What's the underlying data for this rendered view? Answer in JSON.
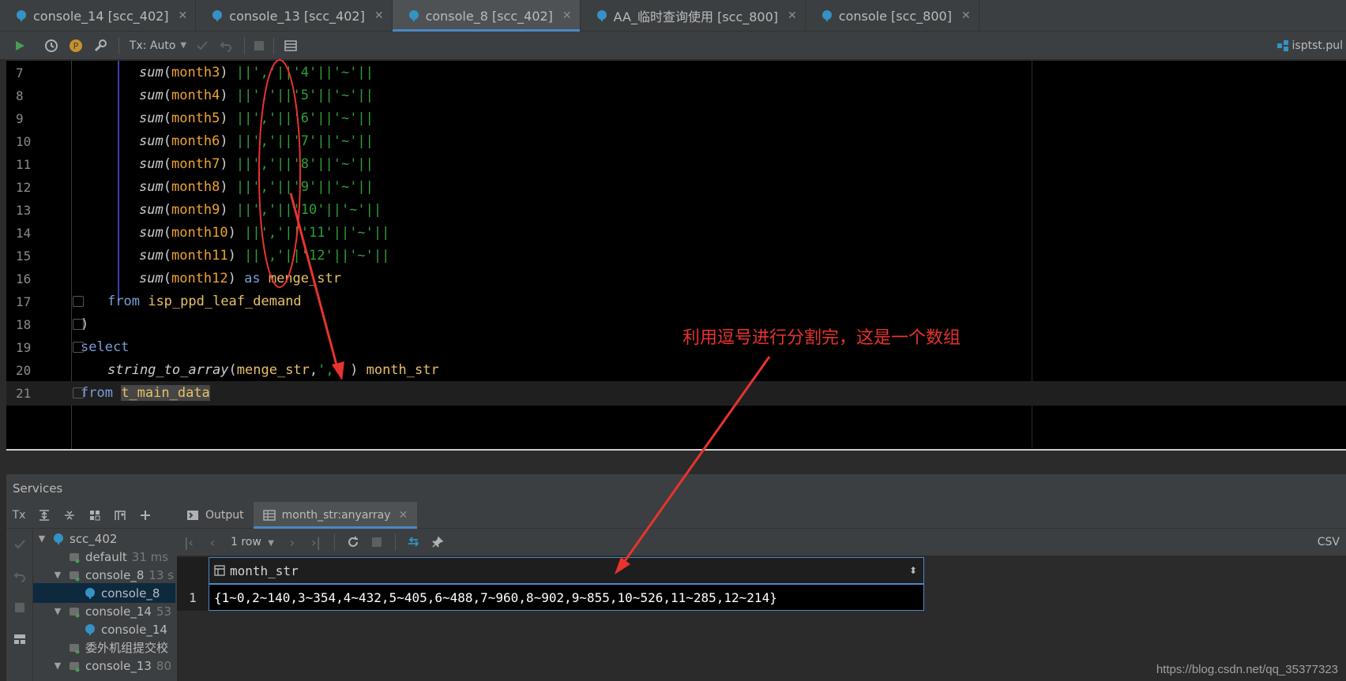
{
  "tabs": [
    {
      "label": "console_14 [scc_402]",
      "active": false
    },
    {
      "label": "console_13 [scc_402]",
      "active": false
    },
    {
      "label": "console_8 [scc_402]",
      "active": true
    },
    {
      "label": "AA_临时查询使用 [scc_800]",
      "active": false
    },
    {
      "label": "console [scc_800]",
      "active": false
    }
  ],
  "toolbar": {
    "tx_mode": "Tx: Auto",
    "datasource": "isptst.pul"
  },
  "editor": {
    "lines": [
      {
        "n": "7",
        "fn": "sum",
        "arg": "month3",
        "sep": "'",
        "num": "4"
      },
      {
        "n": "8",
        "fn": "sum",
        "arg": "month4",
        "num": "5"
      },
      {
        "n": "9",
        "fn": "sum",
        "arg": "month5",
        "num": "6"
      },
      {
        "n": "10",
        "fn": "sum",
        "arg": "month6",
        "num": "7"
      },
      {
        "n": "11",
        "fn": "sum",
        "arg": "month7",
        "num": "8"
      },
      {
        "n": "12",
        "fn": "sum",
        "arg": "month8",
        "num": "9"
      },
      {
        "n": "13",
        "fn": "sum",
        "arg": "month9",
        "num": "10"
      },
      {
        "n": "14",
        "fn": "sum",
        "arg": "month10",
        "num": "11"
      },
      {
        "n": "15",
        "fn": "sum",
        "arg": "month11",
        "num": "12"
      }
    ],
    "line16": {
      "n": "16",
      "fn": "sum",
      "arg": "month12",
      "kw": "as",
      "alias": "menge_str"
    },
    "line17": {
      "n": "17",
      "kw": "from",
      "table": "isp_ppd_leaf_demand"
    },
    "line18": {
      "n": "18",
      "text": ")"
    },
    "line19": {
      "n": "19",
      "kw": "select"
    },
    "line20": {
      "n": "20",
      "fn": "string_to_array",
      "arg": "menge_str",
      "delim": "','",
      "alias": "month_str"
    },
    "line21": {
      "n": "21",
      "kw": "from",
      "table": "t_main_data"
    }
  },
  "annotation": "利用逗号进行分割完，这是一个数组",
  "services": {
    "title": "Services",
    "tx_label": "Tx",
    "tree": [
      {
        "label": "scc_402",
        "meta": "",
        "level": 0,
        "expanded": true
      },
      {
        "label": "default",
        "meta": "31 ms",
        "level": 1
      },
      {
        "label": "console_8",
        "meta": "13 s",
        "level": 1,
        "expanded": true
      },
      {
        "label": "console_8",
        "meta": "",
        "level": 2,
        "selected": true
      },
      {
        "label": "console_14",
        "meta": "53",
        "level": 1,
        "expanded": true
      },
      {
        "label": "console_14",
        "meta": "",
        "level": 2
      },
      {
        "label": "委外机组提交校",
        "meta": "",
        "level": 1
      },
      {
        "label": "console_13",
        "meta": "80",
        "level": 1,
        "expanded": true
      }
    ],
    "result_tabs": [
      {
        "label": "Output",
        "active": false
      },
      {
        "label": "month_str:anyarray",
        "active": true
      }
    ],
    "row_count": "1 row",
    "export": "CSV",
    "column": "month_str",
    "row_number": "1",
    "cell_value": "{1~0,2~140,3~354,4~432,5~405,6~488,7~960,8~902,9~855,10~526,11~285,12~214}"
  },
  "watermark": "https://blog.csdn.net/qq_35377323",
  "colors": {
    "annotation": "#e8332f",
    "accent": "#4a88c7",
    "keyword": "#7a9ed8",
    "identifier": "#eda32e",
    "string": "#2f9f3a"
  }
}
